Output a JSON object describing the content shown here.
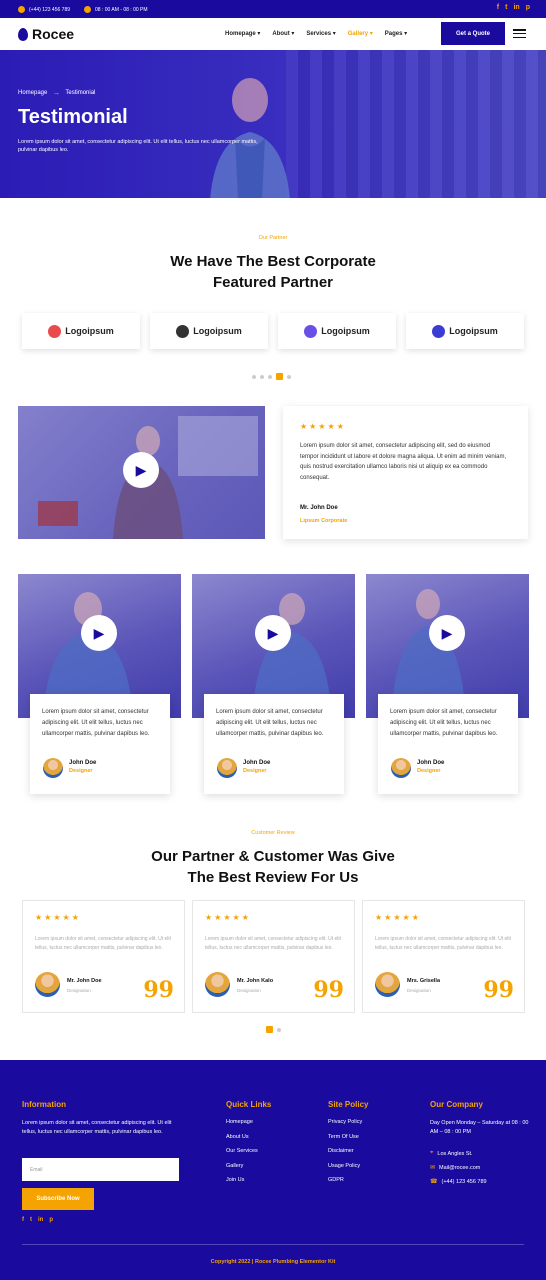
{
  "topbar": {
    "phone": "(+44) 123 456 789",
    "hours": "08 : 00 AM - 08 : 00 PM",
    "social": [
      "f",
      "t",
      "in",
      "p"
    ]
  },
  "nav": {
    "brand": "Rocee",
    "items": [
      {
        "label": "Homepage ▾",
        "active": false
      },
      {
        "label": "About ▾",
        "active": false
      },
      {
        "label": "Services ▾",
        "active": false
      },
      {
        "label": "Gallery ▾",
        "active": true
      },
      {
        "label": "Pages ▾",
        "active": false
      }
    ],
    "cta": "Get a Quote"
  },
  "hero": {
    "crumb_home": "Homepage",
    "crumb_current": "Testimonial",
    "title": "Testimonial",
    "text": "Lorem ipsum dolor sit amet, consectetur adipiscing elit. Ut elit tellus, luctus nec ullamcorper mattis, pulvinar dapibus leo."
  },
  "partner": {
    "eyebrow": "Our Partner",
    "title_line1": "We Have The Best Corporate",
    "title_line2": "Featured Partner",
    "logos": [
      {
        "name": "Logoipsum",
        "color": "#e94b4b"
      },
      {
        "name": "Logoipsum",
        "color": "#333333"
      },
      {
        "name": "Logoipsum",
        "color": "#6a4ee8"
      },
      {
        "name": "Logoipsum",
        "color": "#3b3bd6"
      }
    ]
  },
  "featured_review": {
    "stars": "★★★★★",
    "text": "Lorem ipsum dolor sit amet, consectetur adipiscing elit, sed do eiusmod tempor incididunt ut labore et dolore magna aliqua. Ut enim ad minim veniam, quis nostrud exercitation ullamco laboris nisi ut aliquip ex ea commodo consequat.",
    "name": "Mr. John Doe",
    "company": "Lipsum Corporate"
  },
  "video_cards": [
    {
      "text": "Lorem ipsum dolor sit amet, consectetur adipiscing elit. Ut elit tellus, luctus nec ullamcorper mattis, pulvinar dapibus leo.",
      "name": "John Doe",
      "role": "Designer"
    },
    {
      "text": "Lorem ipsum dolor sit amet, consectetur adipiscing elit. Ut elit tellus, luctus nec ullamcorper mattis, pulvinar dapibus leo.",
      "name": "John Doe",
      "role": "Designer"
    },
    {
      "text": "Lorem ipsum dolor sit amet, consectetur adipiscing elit. Ut elit tellus, luctus nec ullamcorper mattis, pulvinar dapibus leo.",
      "name": "John Doe",
      "role": "Designer"
    }
  ],
  "customer": {
    "eyebrow": "Customer Review",
    "title_line1": "Our Partner & Customer Was Give",
    "title_line2": "The Best Review For Us",
    "reviews": [
      {
        "stars": "★★★★★",
        "text": "Lorem ipsum dolor sit amet, consectetur adipiscing elit. Ut elit tellus, luctus nec ullamcorper mattis, pulvinar dapibus leo.",
        "name": "Mr. John Doe",
        "role": "Designation"
      },
      {
        "stars": "★★★★★",
        "text": "Lorem ipsum dolor sit amet, consectetur adipiscing elit. Ut elit tellus, luctus nec ullamcorper mattis, pulvinar dapibus leo.",
        "name": "Mr. John Kalo",
        "role": "Designation"
      },
      {
        "stars": "★★★★★",
        "text": "Lorem ipsum dolor sit amet, consectetur adipiscing elit. Ut elit tellus, luctus nec ullamcorper mattis, pulvinar dapibus leo.",
        "name": "Mrs. Grisella",
        "role": "Designation"
      }
    ],
    "quote_mark": "99"
  },
  "footer": {
    "info_title": "Information",
    "info_text": "Lorem ipsum dolor sit amet, consectetur adipiscing elit. Ut elit tellus, luctus nec ullamcorper mattis, pulvinar dapibus leo.",
    "email_placeholder": "Email",
    "subscribe": "Subscribe Now",
    "social": [
      "f",
      "t",
      "in",
      "p"
    ],
    "quick_title": "Quick Links",
    "quick_links": [
      "Homepage",
      "About Us",
      "Our Services",
      "Gallery",
      "Join Us"
    ],
    "policy_title": "Site Policy",
    "policy_links": [
      "Privacy Policy",
      "Term Of Use",
      "Disclaimer",
      "Usage Policy",
      "GDPR"
    ],
    "company_title": "Our Company",
    "company_hours": "Day Open Monday – Saturday at 08 : 00 AM – 08 : 00 PM",
    "address": "Los Angles St.",
    "email": "Mail@rocee.com",
    "phone": "(+44) 123 456 789",
    "copyright": "Copyright 2022 | Rocee Plumbing Elementor Kit"
  },
  "colors": {
    "primary": "#1a0a9e",
    "accent": "#f5a300"
  },
  "icons": [
    "phone-icon",
    "clock-icon",
    "facebook-icon",
    "twitter-icon",
    "linkedin-icon",
    "pinterest-icon",
    "play-icon",
    "star-icon",
    "quote-icon",
    "location-icon",
    "mail-icon",
    "hamburger-icon"
  ]
}
